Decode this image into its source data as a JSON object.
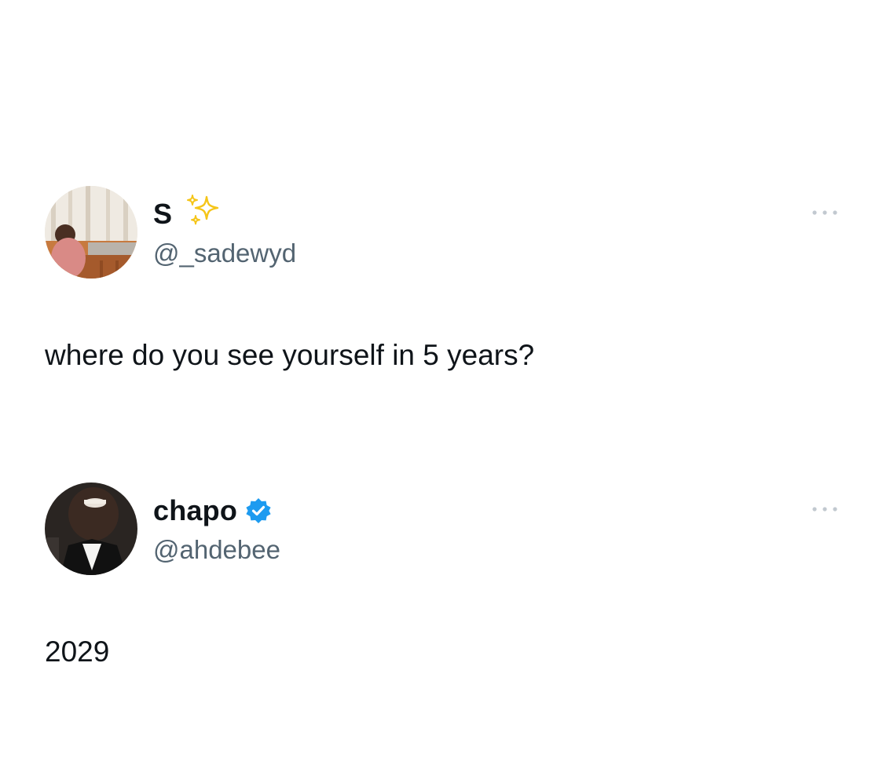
{
  "tweets": [
    {
      "display_name": "S",
      "name_emoji": "sparkles-icon",
      "handle": "@_sadewyd",
      "text": "where do you see yourself in 5 years?",
      "more_icon": "more-options-icon"
    },
    {
      "display_name": "chapo",
      "badge": "verified-badge-icon",
      "handle": "@ahdebee",
      "text": "2029",
      "more_icon": "more-options-icon"
    }
  ],
  "colors": {
    "text": "#0f1419",
    "secondary": "#536471",
    "verified": "#1d9bf0",
    "sparkle": "#f5c518",
    "more_dots": "#c2c9d0"
  }
}
